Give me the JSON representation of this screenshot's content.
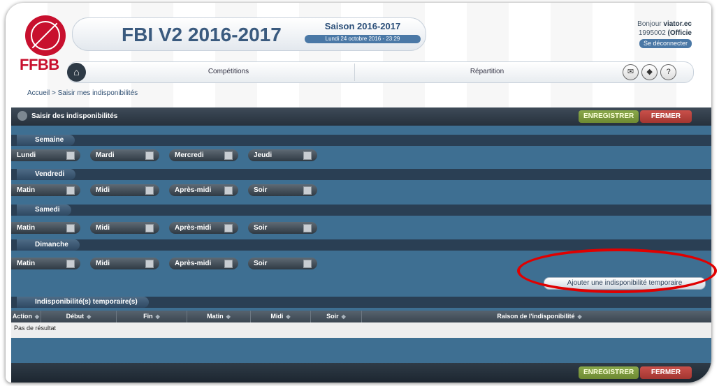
{
  "brand": {
    "logo_text": "FFBB"
  },
  "header": {
    "app_title": "FBI V2 2016-2017",
    "season": "Saison 2016-2017",
    "date": "Lundi 24 octobre 2016 - 23:29"
  },
  "user": {
    "greeting": "Bonjour",
    "name": "viator.ec",
    "id": "1995002",
    "role": "(Officie",
    "logout": "Se déconnecter"
  },
  "nav": {
    "items": [
      {
        "label": "Compétitions"
      },
      {
        "label": "Répartition"
      }
    ],
    "icons": [
      "mail-icon",
      "book-icon",
      "help-icon"
    ],
    "help_glyph": "?"
  },
  "breadcrumb": "Accueil > Saisir mes indisponibilités",
  "panel": {
    "title": "Saisir des indisponibilités",
    "save_label": "ENREGISTRER",
    "close_label": "FERMER"
  },
  "sections": [
    {
      "label": "Semaine",
      "options": [
        "Lundi",
        "Mardi",
        "Mercredi",
        "Jeudi"
      ]
    },
    {
      "label": "Vendredi",
      "options": [
        "Matin",
        "Midi",
        "Après-midi",
        "Soir"
      ]
    },
    {
      "label": "Samedi",
      "options": [
        "Matin",
        "Midi",
        "Après-midi",
        "Soir"
      ]
    },
    {
      "label": "Dimanche",
      "options": [
        "Matin",
        "Midi",
        "Après-midi",
        "Soir"
      ]
    }
  ],
  "add_temporary": "Ajouter une indisponibilité temporaire",
  "temporary": {
    "label": "Indisponibilité(s) temporaire(s)",
    "columns": [
      "Action",
      "Début",
      "Fin",
      "Matin",
      "Midi",
      "Soir",
      "Raison de l'indisponibilité"
    ],
    "empty": "Pas de résultat"
  },
  "footer": {
    "save_label": "ENREGISTRER",
    "close_label": "FERMER"
  },
  "colors": {
    "brand_red": "#c8102e",
    "panel_blue": "#3e6f92",
    "save_green": "#7a9a3e",
    "close_red": "#b23f3a",
    "highlight_red": "#e00000"
  }
}
